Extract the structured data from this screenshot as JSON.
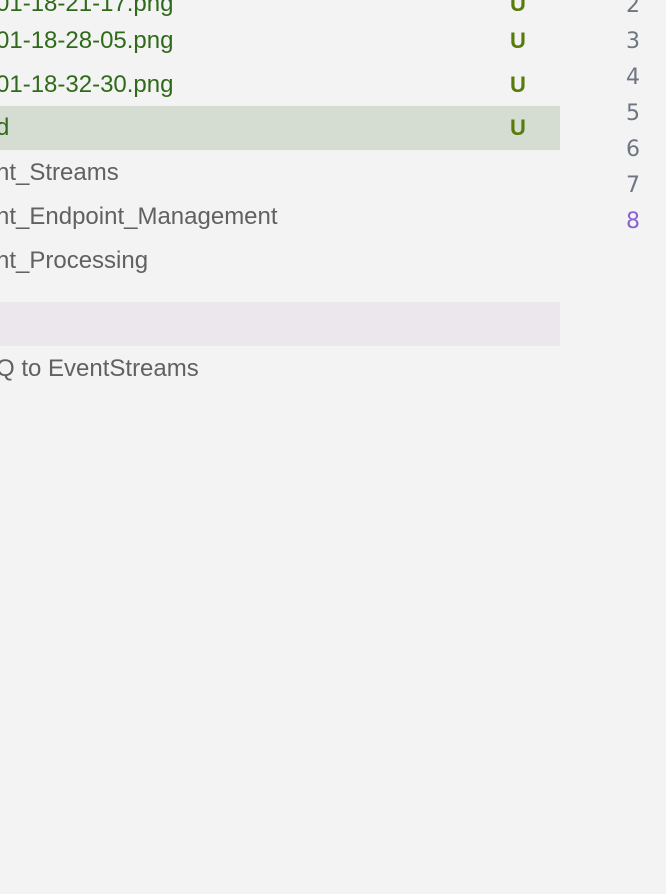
{
  "explorer": {
    "items": [
      {
        "name": "01-18-21-17.png",
        "badge": "U",
        "status": "untracked"
      },
      {
        "name": "01-18-28-05.png",
        "badge": "U",
        "status": "untracked"
      },
      {
        "name": "01-18-32-30.png",
        "badge": "U",
        "status": "untracked"
      },
      {
        "name": "d",
        "badge": "U",
        "status": "untracked-selected"
      },
      {
        "name": "nt_Streams",
        "badge": "",
        "status": "normal"
      },
      {
        "name": "nt_Endpoint_Management",
        "badge": "",
        "status": "normal"
      },
      {
        "name": "nt_Processing",
        "badge": "",
        "status": "normal"
      },
      {
        "name": "",
        "badge": "",
        "status": "hover"
      },
      {
        "name": "Q to EventStreams",
        "badge": "",
        "status": "normal"
      }
    ]
  },
  "editor": {
    "line_numbers": [
      "2",
      "3",
      "4",
      "5",
      "6",
      "7",
      "8"
    ],
    "active_line": "8",
    "active_color": "#8a63d2"
  }
}
